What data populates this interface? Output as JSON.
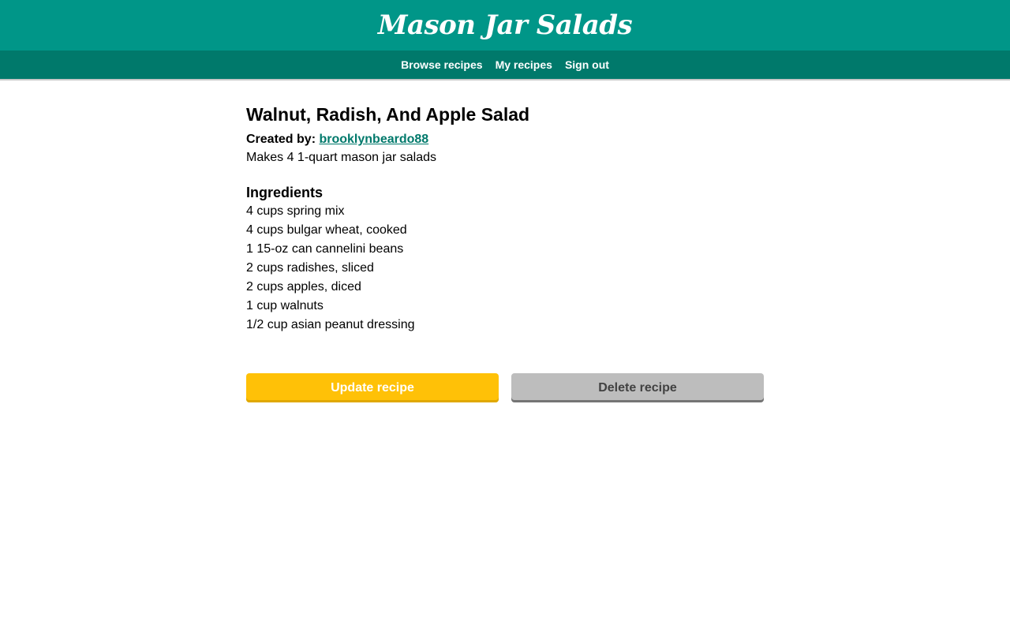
{
  "header": {
    "site_title": "Mason Jar Salads"
  },
  "nav": {
    "items": [
      {
        "label": "Browse recipes"
      },
      {
        "label": "My recipes"
      },
      {
        "label": "Sign out"
      }
    ]
  },
  "recipe": {
    "title": "Walnut, Radish, And Apple Salad",
    "created_by_label": "Created by:",
    "creator": "brooklynbeardo88",
    "yield": "Makes 4 1-quart mason jar salads",
    "ingredients_heading": "Ingredients",
    "ingredients": [
      "4 cups spring mix",
      "4 cups bulgar wheat, cooked",
      "1 15-oz can cannelini beans",
      "2 cups radishes, sliced",
      "2 cups apples, diced",
      "1 cup walnuts",
      "1/2 cup asian peanut dressing"
    ]
  },
  "actions": {
    "update_label": "Update recipe",
    "delete_label": "Delete recipe"
  },
  "colors": {
    "header_bg": "#009688",
    "nav_bg": "#00796b",
    "link": "#00796b",
    "update_button": "#ffc107",
    "delete_button": "#bdbdbd"
  }
}
